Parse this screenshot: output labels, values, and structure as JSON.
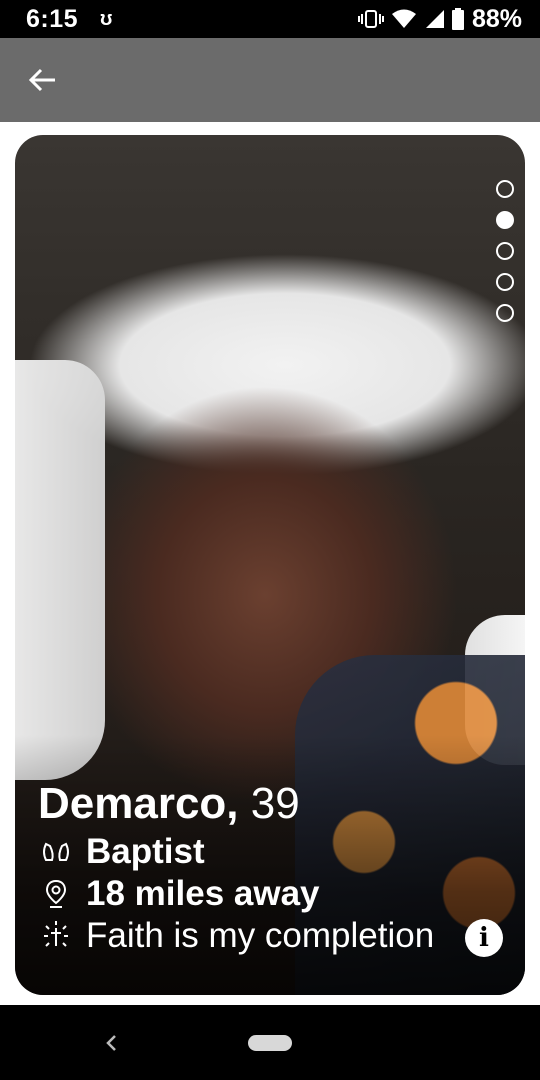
{
  "status_bar": {
    "time": "6:15",
    "app_icon": "ʊ",
    "battery_percent": "88%"
  },
  "app_bar": {
    "back_icon": "arrow-left-icon"
  },
  "card": {
    "photo_count": 5,
    "active_photo_index": 1,
    "name": "Demarco,",
    "age": "39",
    "denomination": "Baptist",
    "distance": "18 miles away",
    "tagline": "Faith is my completion",
    "info_icon_label": "i",
    "icons": {
      "denomination": "praying-hands-icon",
      "distance": "location-pin-icon",
      "tagline": "cross-sunburst-icon",
      "info": "info-icon"
    }
  },
  "colors": {
    "app_bar": "#6b6b6b",
    "status_bar": "#000000",
    "nav_bar": "#000000",
    "text_on_photo": "#ffffff"
  }
}
